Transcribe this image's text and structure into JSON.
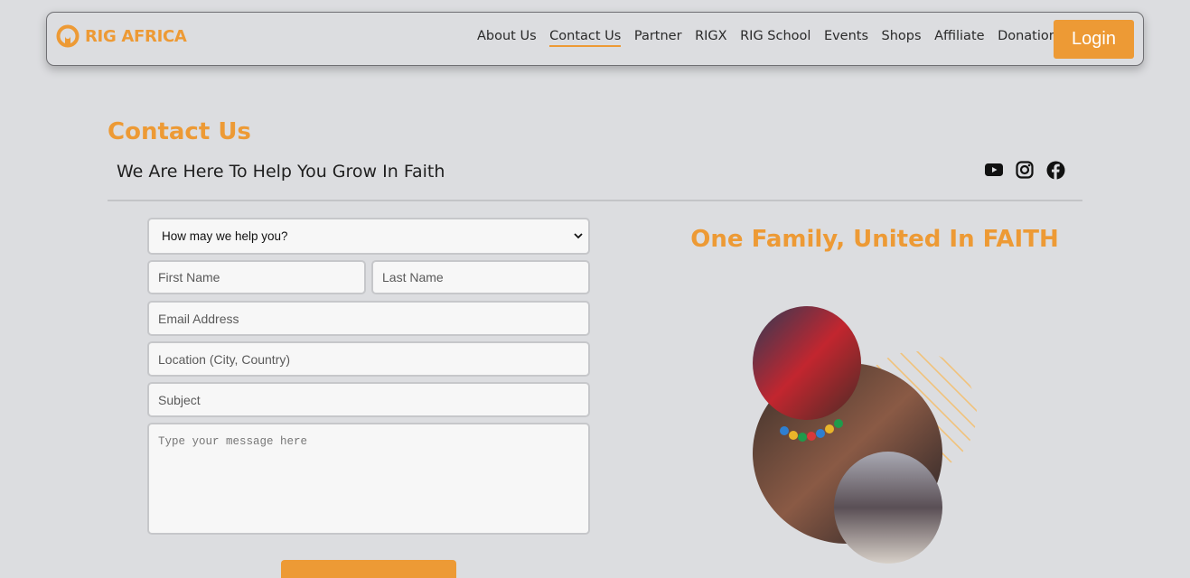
{
  "brand": {
    "name": "RIG AFRICA",
    "accent": "#ed9a35"
  },
  "nav": {
    "links": [
      {
        "label": "About Us",
        "active": false
      },
      {
        "label": "Contact Us",
        "active": true
      },
      {
        "label": "Partner",
        "active": false
      },
      {
        "label": "RIGX",
        "active": false
      },
      {
        "label": "RIG School",
        "active": false
      },
      {
        "label": "Events",
        "active": false
      },
      {
        "label": "Shops",
        "active": false
      },
      {
        "label": "Affiliate",
        "active": false
      },
      {
        "label": "Donation",
        "active": false
      }
    ],
    "login_label": "Login"
  },
  "header": {
    "title": "Contact Us",
    "tagline": "We Are Here To Help You Grow In Faith",
    "socials": [
      "youtube-icon",
      "instagram-icon",
      "facebook-icon"
    ]
  },
  "form": {
    "help_select": {
      "value": "How may we help you?"
    },
    "first_name": {
      "placeholder": "First Name"
    },
    "last_name": {
      "placeholder": "Last Name"
    },
    "email": {
      "placeholder": "Email Address"
    },
    "location": {
      "placeholder": "Location (City, Country)"
    },
    "subject": {
      "placeholder": "Subject"
    },
    "message": {
      "placeholder": "Type your message here"
    }
  },
  "aside": {
    "title": "One Family, United In FAITH"
  }
}
